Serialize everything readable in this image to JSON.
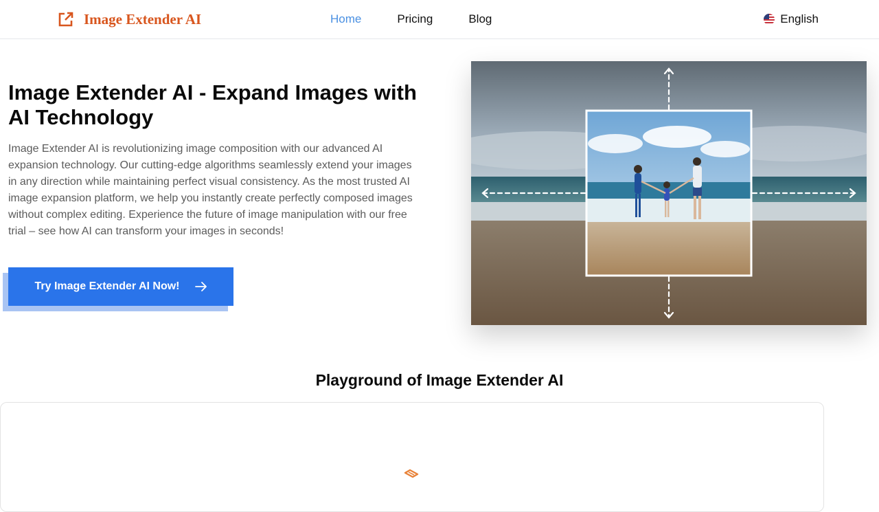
{
  "header": {
    "logo_text": "Image Extender AI",
    "logo_icon": "external-link-icon",
    "nav": [
      {
        "label": "Home",
        "active": true
      },
      {
        "label": "Pricing",
        "active": false
      },
      {
        "label": "Blog",
        "active": false
      }
    ],
    "language": {
      "label": "English",
      "icon": "us-flag-icon"
    }
  },
  "hero": {
    "title": "Image Extender AI - Expand Images with AI Technology",
    "description": "Image Extender AI is revolutionizing image composition with our advanced AI expansion technology. Our cutting-edge algorithms seamlessly extend your images in any direction while maintaining perfect visual consistency. As the most trusted AI image expansion platform, we help you instantly create perfectly composed images without complex editing. Experience the future of image manipulation with our free trial – see how AI can transform your images in seconds!",
    "cta_label": "Try Image Extender AI Now!",
    "cta_icon": "arrow-right-icon"
  },
  "playground": {
    "title": "Playground of Image Extender AI",
    "loading_icon": "loading-icon"
  },
  "colors": {
    "brand": "#d8561e",
    "nav_active": "#4a90e2",
    "cta": "#2a74ea",
    "cta_shadow": "#a9c4f3"
  }
}
